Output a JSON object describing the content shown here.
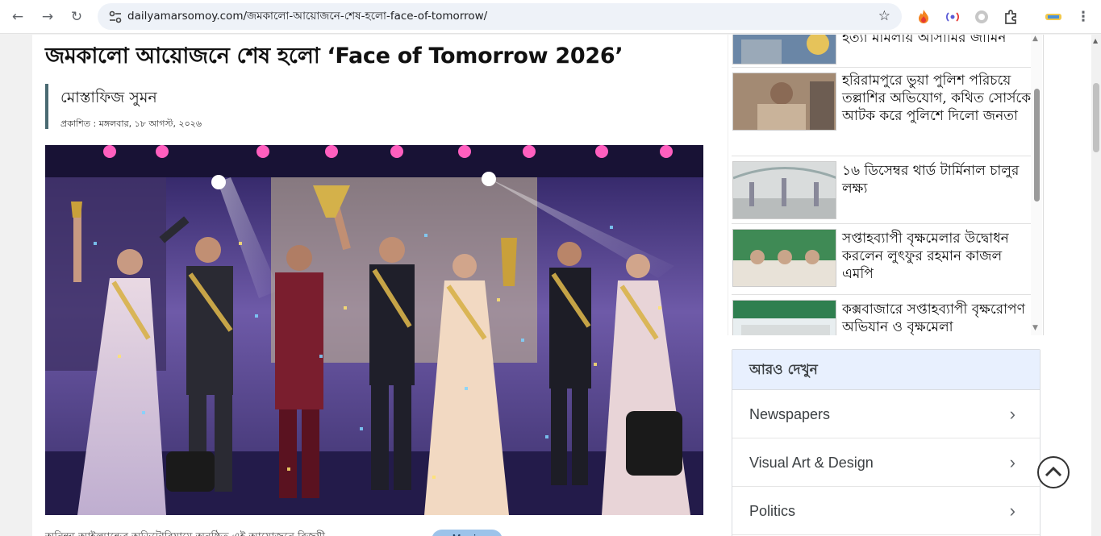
{
  "browser": {
    "url": "dailyamarsomoy.com/জমকালো-আয়োজনে-শেষ-হলো-face-of-tomorrow/",
    "back_icon": "←",
    "forward_icon": "→",
    "reload_icon": "↻",
    "star_icon": "☆",
    "menu_icon": "⋮"
  },
  "article": {
    "headline": "জমকালো আয়োজনে শেষ হলো ‘Face of Tomorrow 2026’",
    "author": "মোস্তাফিজ সুমন",
    "published": "প্রকাশিত : মঙ্গলবার, ১৮ আগস্ট, ২০২৬",
    "below_photo_text": "অনিন্দ্য আইল্যান্ডের অডিটোরিয়ামে অনুষ্ঠিত এই আয়োজনে বিজয়ী...",
    "tag_label": "Music"
  },
  "sidebar": {
    "items": [
      {
        "title": "হত্যা মামলায় আসামির জামিন"
      },
      {
        "title": "হরিরামপুরে ভুয়া পুলিশ পরিচয়ে তল্লাশির অভিযোগ, কথিত সোর্সকে আটক করে পুলিশে দিলো জনতা"
      },
      {
        "title": "১৬ ডিসেম্বর থার্ড টার্মিনাল চালুর লক্ষ্য"
      },
      {
        "title": "সপ্তাহব্যাপী বৃক্ষমেলার উদ্বোধন করলেন লুৎফুর রহমান কাজল এমপি"
      },
      {
        "title": "কক্সবাজারে সপ্তাহব্যাপী বৃক্ষরোপণ অভিযান ও বৃক্ষমেলা"
      }
    ]
  },
  "more": {
    "heading": "আরও দেখুন",
    "items": [
      {
        "label": "Newspapers"
      },
      {
        "label": "Visual Art & Design"
      },
      {
        "label": "Politics"
      }
    ],
    "chevron": "›"
  },
  "colors": {
    "byline_bar": "#4a6a72",
    "more_header_bg": "#e8f0fe",
    "omnibox_bg": "#eef2f8"
  }
}
